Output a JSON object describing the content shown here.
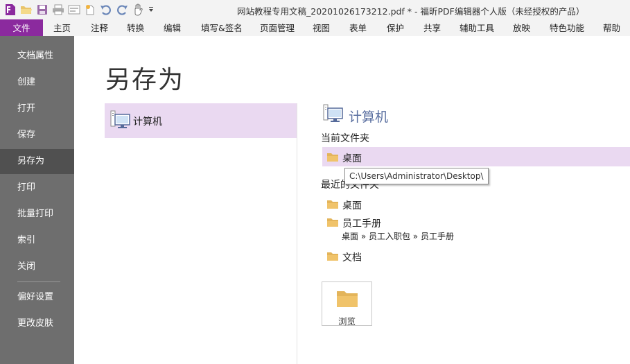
{
  "window": {
    "title": "网站教程专用文稿_20201026173212.pdf * - 福昕PDF编辑器个人版（未经授权的产品）"
  },
  "quick_access": {
    "icons": [
      "app-logo-icon",
      "open-folder-icon",
      "save-icon",
      "print-icon",
      "form-icon",
      "new-icon",
      "undo-icon",
      "redo-icon",
      "hand-tool-icon",
      "customize-dropdown-icon"
    ]
  },
  "menu": {
    "items": [
      "文件",
      "主页",
      "注释",
      "转换",
      "编辑",
      "填写&签名",
      "页面管理",
      "视图",
      "表单",
      "保护",
      "共享",
      "辅助工具",
      "放映",
      "特色功能",
      "帮助"
    ],
    "active": "文件"
  },
  "backstage_nav": {
    "items": [
      "文档属性",
      "创建",
      "打开",
      "保存",
      "另存为",
      "打印",
      "批量打印",
      "索引",
      "关闭",
      "偏好设置",
      "更改皮肤"
    ],
    "active": "另存为"
  },
  "page": {
    "title": "另存为"
  },
  "places": {
    "items": [
      {
        "label": "计算机",
        "icon": "computer-icon"
      }
    ]
  },
  "panel": {
    "title": "计算机",
    "current_folder_label": "当前文件夹",
    "current_folder": {
      "name": "桌面",
      "tooltip": "C:\\Users\\Administrator\\Desktop\\"
    },
    "recent_label": "最近的文件夹",
    "recent_folders": [
      {
        "name": "桌面"
      },
      {
        "name": "员工手册",
        "path": "桌面 » 员工入职包 » 员工手册"
      },
      {
        "name": "文档"
      }
    ],
    "browse_label": "浏览"
  },
  "colors": {
    "accent": "#8b2a9e",
    "selection": "#ead9f1",
    "nav_bg": "#6e6e6e",
    "nav_active": "#505050",
    "section_title": "#5a6fa0",
    "folder": "#f0c36a"
  }
}
